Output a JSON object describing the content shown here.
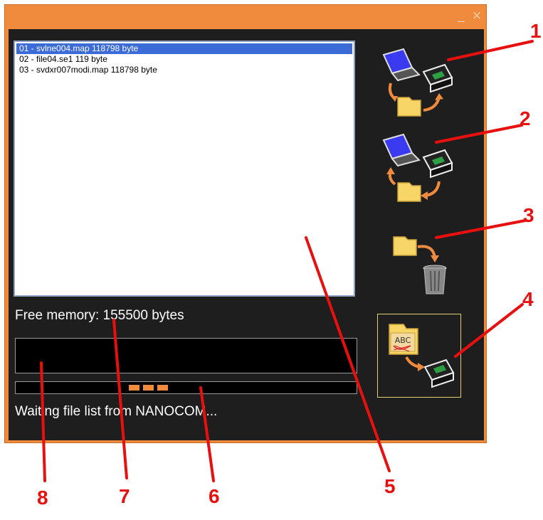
{
  "window": {
    "controls": {
      "minimize": "_",
      "close": "×"
    }
  },
  "file_list": {
    "items": [
      {
        "label": "01 - svlne004.map 118798 byte",
        "selected": true
      },
      {
        "label": "02 - file04.se1 119 byte",
        "selected": false
      },
      {
        "label": "03 - svdxr007modi.map 118798 byte",
        "selected": false
      }
    ]
  },
  "free_memory": "Free memory: 155500 bytes",
  "status": "Waiting file list from NANOCOM...",
  "progress": {
    "blocks_lit": 3
  },
  "toolbar": [
    {
      "icon": "download-from-device-icon"
    },
    {
      "icon": "upload-to-device-icon"
    },
    {
      "icon": "delete-file-icon"
    },
    {
      "icon": "rename-and-send-icon",
      "label": "ABC"
    }
  ],
  "callouts": [
    "1",
    "2",
    "3",
    "4",
    "5",
    "6",
    "7",
    "8"
  ],
  "colors": {
    "frame": "#f08a3c",
    "client": "#1e1e1e",
    "selection": "#3a6bd6",
    "callout": "#e8100f",
    "active_border": "#e2d26d"
  }
}
